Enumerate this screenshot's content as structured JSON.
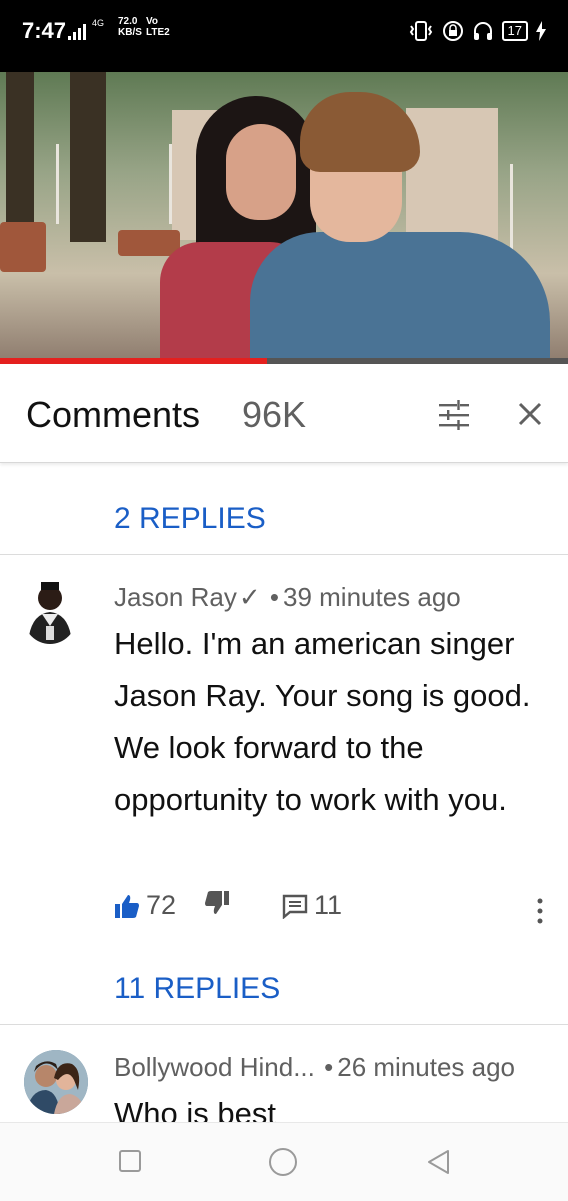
{
  "status_bar": {
    "time": "7:47",
    "network_type": "4G",
    "speed_value": "72.0",
    "speed_unit": "KB/S",
    "volte": "Vo",
    "lte": "LTE2",
    "battery": "17",
    "icons": [
      "signal-icon",
      "vibrate-icon",
      "lock-rotation-icon",
      "headset-icon",
      "battery-icon",
      "charging-icon"
    ]
  },
  "video": {
    "progress_fraction": 0.47,
    "progress_color": "#e4201e"
  },
  "comments_header": {
    "title": "Comments",
    "count": "96K"
  },
  "replies_top": "2 REPLIES",
  "comments": [
    {
      "author": "Jason Ray",
      "verified_mark": "✓",
      "separator": "•",
      "time": "39 minutes ago",
      "text": "Hello. I'm an american singer Jason Ray. Your song is good. We look forward to the opportunity to work with you.",
      "likes": "72",
      "reply_count": "11",
      "replies_label": "11 REPLIES"
    },
    {
      "author": "Bollywood Hind...",
      "separator": "•",
      "time": "26 minutes ago",
      "text": "Who is best"
    }
  ],
  "colors": {
    "link_blue": "#1a5ec6",
    "like_blue": "#1a5ec6",
    "meta_gray": "#606060"
  }
}
